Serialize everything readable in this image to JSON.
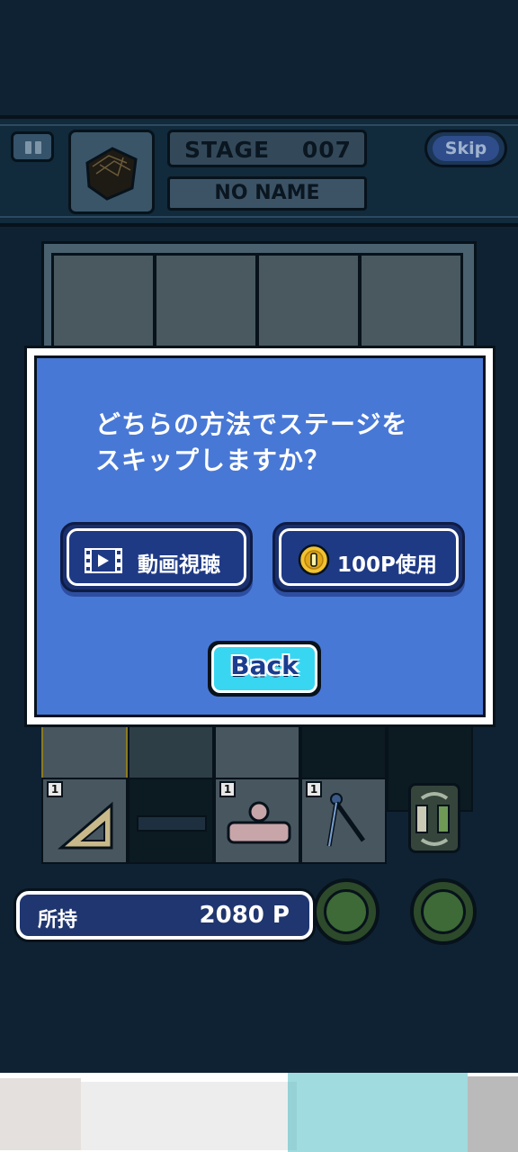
{
  "header": {
    "stage_label": "STAGE",
    "stage_number": "007",
    "stage_name": "NO NAME",
    "skip_label": "Skip"
  },
  "dialog": {
    "question_line1": "どちらの方法でステージを",
    "question_line2": "スキップしますか？",
    "option_video_label": "動画視聴",
    "option_points_label": "100P使用",
    "back_label": "Back"
  },
  "grid": {
    "counts": [
      "1",
      "1",
      "1"
    ]
  },
  "owned": {
    "label": "所持",
    "value": "2080 P"
  },
  "colors": {
    "background": "#0f2233",
    "dialog_blue": "#4878d6",
    "button_navy": "#1f3a85",
    "back_cyan": "#39d6f2",
    "coin_gold": "#f2c230"
  }
}
